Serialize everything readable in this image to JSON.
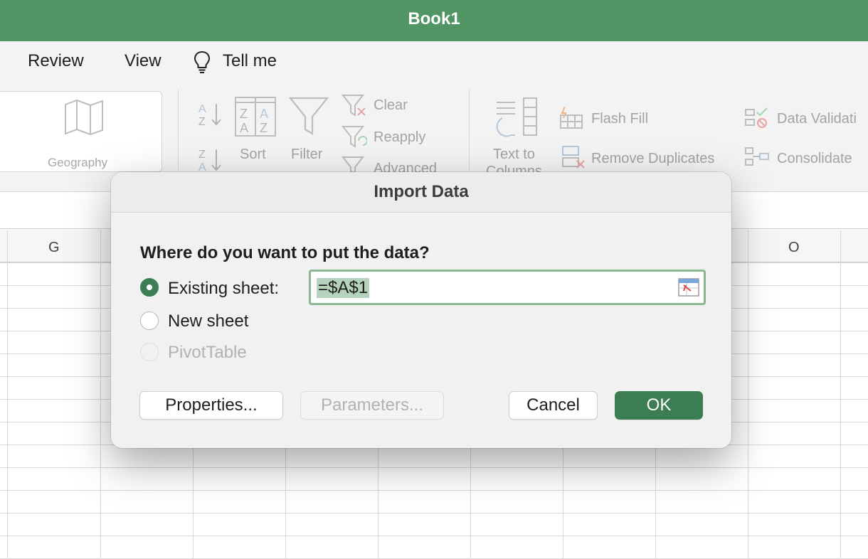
{
  "window": {
    "title": "Book1"
  },
  "menu": {
    "review": "Review",
    "view": "View",
    "tell_me": "Tell me",
    "tell_me_icon": "lightbulb-icon"
  },
  "ribbon": {
    "geography": "Geography",
    "sort": "Sort",
    "filter": "Filter",
    "clear": "Clear",
    "reapply": "Reapply",
    "advanced": "Advanced",
    "text_to_columns_line1": "Text to",
    "text_to_columns_line2": "Columns",
    "flash_fill": "Flash Fill",
    "remove_duplicates": "Remove Duplicates",
    "data_validation": "Data Validati",
    "consolidate": "Consolidate"
  },
  "grid": {
    "col_g": "G",
    "col_o": "O"
  },
  "dialog": {
    "title": "Import Data",
    "question": "Where do you want to put the data?",
    "option_existing": "Existing sheet:",
    "option_new": "New sheet",
    "option_pivot": "PivotTable",
    "selected_option": "Existing sheet:",
    "cell_reference": "=$A$1",
    "properties_button": "Properties...",
    "parameters_button": "Parameters...",
    "cancel_button": "Cancel",
    "ok_button": "OK"
  },
  "colors": {
    "title_bar": "#509563",
    "accent": "#3d7d54",
    "selection_highlight": "#b5d3bc"
  }
}
